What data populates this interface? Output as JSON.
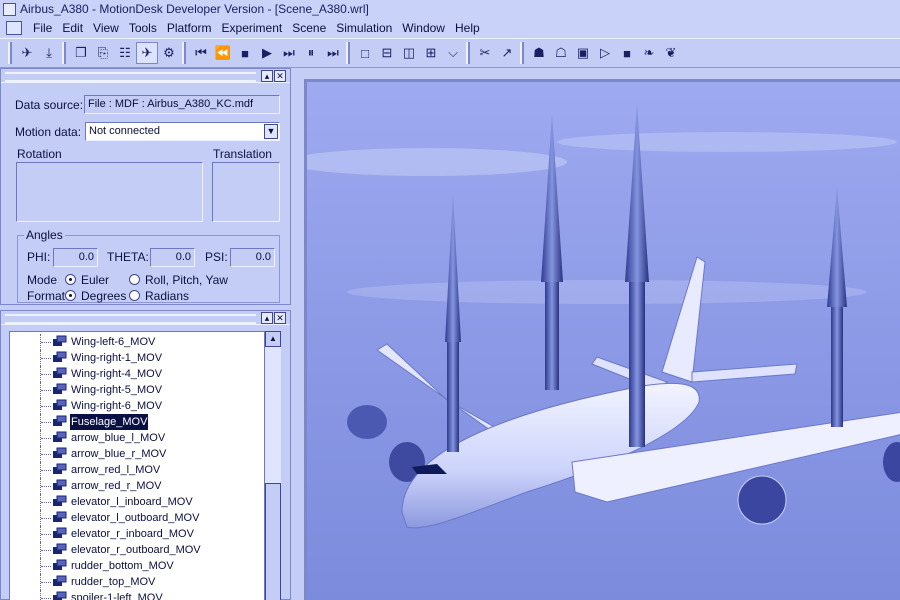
{
  "window": {
    "title": "Airbus_A380 - MotionDesk Developer Version - [Scene_A380.wrl]"
  },
  "menu": [
    "File",
    "Edit",
    "View",
    "Tools",
    "Platform",
    "Experiment",
    "Scene",
    "Simulation",
    "Window",
    "Help"
  ],
  "panel_top": {
    "data_source_label": "Data source:",
    "data_source_value": "File : MDF : Airbus_A380_KC.mdf",
    "motion_data_label": "Motion data:",
    "motion_data_value": "Not connected",
    "rotation_label": "Rotation",
    "translation_label": "Translation",
    "angles": {
      "group_label": "Angles",
      "phi_label": "PHI:",
      "phi_value": "0.0",
      "theta_label": "THETA:",
      "theta_value": "0.0",
      "psi_label": "PSI:",
      "psi_value": "0.0",
      "mode_label": "Mode",
      "mode_euler": "Euler",
      "mode_rpy": "Roll, Pitch, Yaw",
      "format_label": "Format",
      "format_degrees": "Degrees",
      "format_radians": "Radians"
    }
  },
  "tree": {
    "items": [
      "Wing-left-6_MOV",
      "Wing-right-1_MOV",
      "Wing-right-4_MOV",
      "Wing-right-5_MOV",
      "Wing-right-6_MOV",
      "Fuselage_MOV",
      "arrow_blue_l_MOV",
      "arrow_blue_r_MOV",
      "arrow_red_l_MOV",
      "arrow_red_r_MOV",
      "elevator_l_inboard_MOV",
      "elevator_l_outboard_MOV",
      "elevator_r_inboard_MOV",
      "elevator_r_outboard_MOV",
      "rudder_bottom_MOV",
      "rudder_top_MOV",
      "spoiler-1-left_MOV"
    ],
    "selected": "Fuselage_MOV"
  },
  "colors": {
    "background": "#c4cdf6",
    "selection": "#0b1042",
    "viewport_sky": "#8a98e6"
  }
}
